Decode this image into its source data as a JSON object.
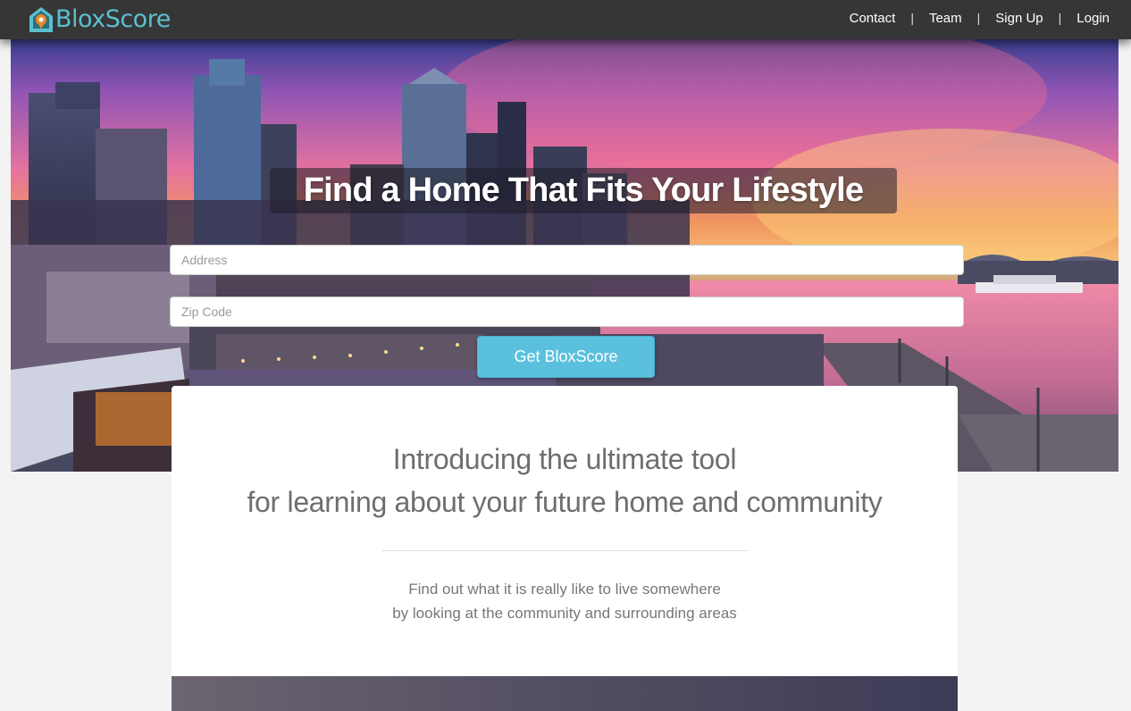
{
  "brand": {
    "name": "BloxScore"
  },
  "nav": {
    "items": [
      {
        "label": "Contact"
      },
      {
        "label": "Team"
      },
      {
        "label": "Sign Up"
      },
      {
        "label": "Login"
      }
    ],
    "separator": "|"
  },
  "hero": {
    "title": "Find a Home That Fits Your Lifestyle",
    "address_placeholder": "Address",
    "zip_placeholder": "Zip Code",
    "submit_label": "Get BloxScore"
  },
  "intro": {
    "heading_line1": "Introducing the ultimate tool",
    "heading_line2": "for learning about your future home and community",
    "body_line1": "Find out what it is really like to live somewhere",
    "body_line2": "by looking at the community and surrounding areas"
  },
  "colors": {
    "navbar": "#363636",
    "brand_teal": "#5bc0cf",
    "brand_orange": "#e8892b",
    "button": "#5bc0de",
    "heading_text": "#6e6e6e",
    "body_text": "#777777"
  },
  "icons": {
    "brand_logo": "house-pin-icon"
  }
}
